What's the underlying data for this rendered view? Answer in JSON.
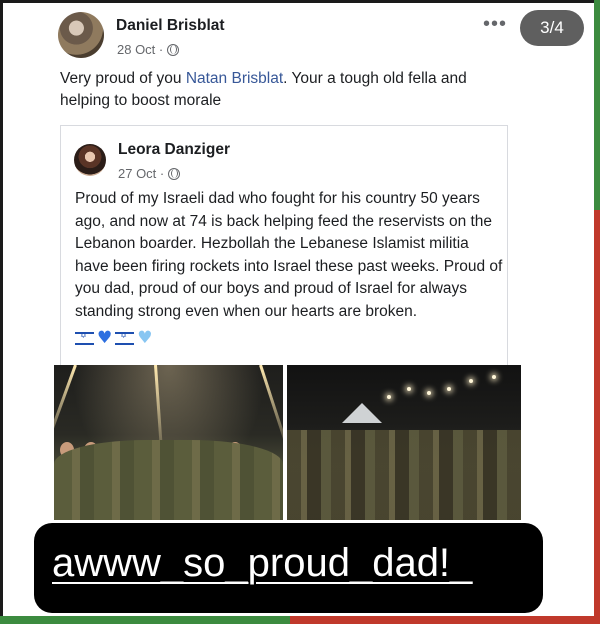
{
  "story": {
    "counter": "3/4",
    "caption": "awww_so_proud_dad!_"
  },
  "post": {
    "author": "Daniel Brisblat",
    "date": "28 Oct ·",
    "text_before": "Very proud of you ",
    "mention": "Natan Brisblat",
    "text_after": ". Your a tough old fella and helping to boost morale",
    "more_icon": "•••"
  },
  "shared_post": {
    "author": "Leora Danziger",
    "date": "27 Oct ·",
    "text": "Proud of my Israeli dad who fought for his country 50 years ago, and now at 74 is back helping feed the reservists on the Lebanon boarder.  Hezbollah the Lebanese Islamist militia have been firing rockets into Israel these past weeks.  Proud of you dad, proud of our boys and proud of Israel for always standing strong even when our hearts are broken.",
    "emojis": [
      "israel-flag",
      "blue-heart",
      "israel-flag",
      "light-blue-heart"
    ]
  },
  "colors": {
    "link": "#385898",
    "meta": "#65676b",
    "counter_bg": "#5f5f5f",
    "caption_bg": "#000000"
  }
}
